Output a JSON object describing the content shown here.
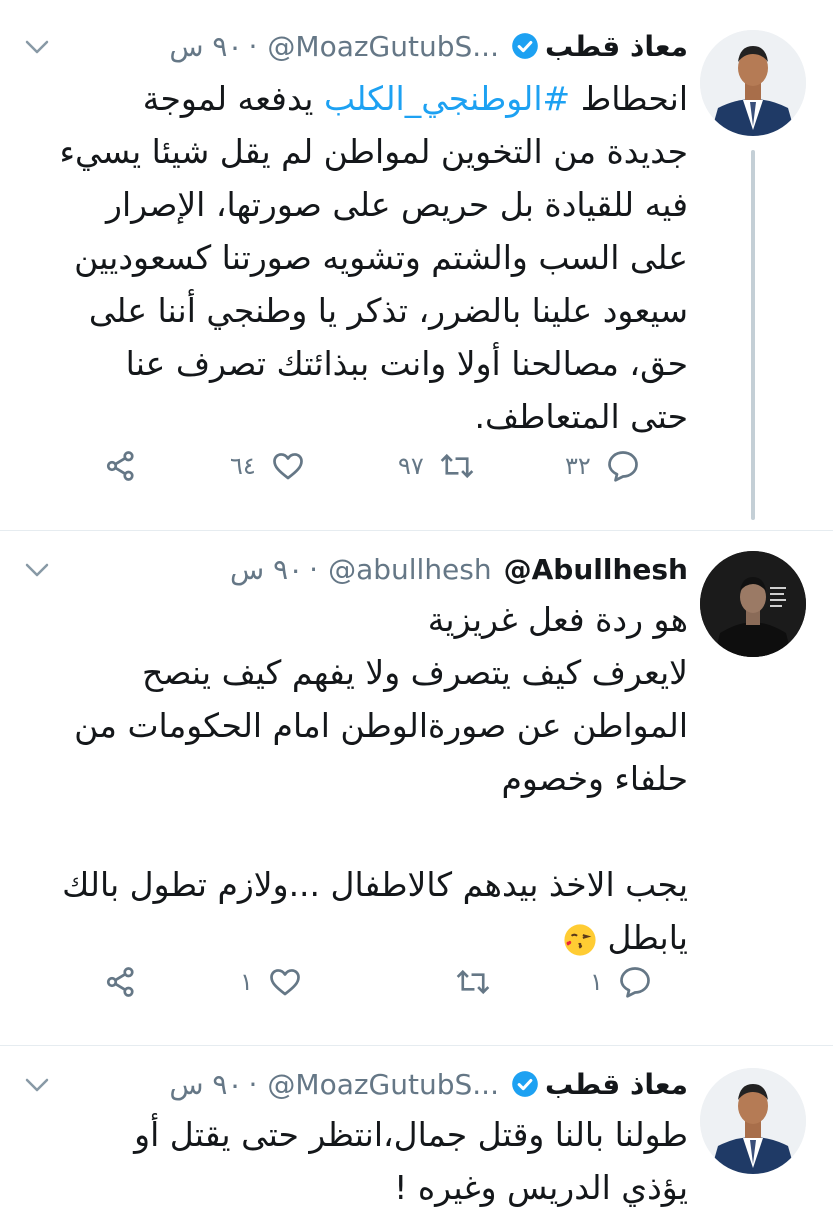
{
  "tweets": [
    {
      "name": "معاذ قطب",
      "verified": true,
      "handle": "@MoazGutubS...",
      "time": "٩٠ س",
      "hashtag": "#الوطنجي_الكلب",
      "lines": [
        "انحطاط",
        "يدفعه لموجة",
        "جديدة من التخوين لمواطن لم يقل شيئا يسيء",
        "فيه للقيادة بل حريص على صورتها، الإصرار",
        "على السب والشتم وتشويه صورتنا كسعوديين",
        "سيعود علينا بالضرر، تذكر يا وطنجي أننا على",
        "حق، مصالحنا أولا وانت ببذائتك تصرف عنا",
        "حتى المتعاطف."
      ],
      "replies": "٣٢",
      "retweets": "٩٧",
      "likes": "٦٤"
    },
    {
      "name": "@Abullhesh",
      "verified": false,
      "handle": "@abullhesh",
      "time": "٩٠ س",
      "lines": [
        "هو ردة فعل غريزية",
        "لايعرف كيف يتصرف ولا يفهم كيف ينصح",
        "المواطن عن صورةالوطن امام الحكومات من",
        "حلفاء وخصوم",
        "",
        "يجب الاخذ بيدهم كالاطفال ...ولازم تطول بالك",
        "يابطل"
      ],
      "replies": "١",
      "retweets": "",
      "likes": "١"
    },
    {
      "name": "معاذ قطب",
      "verified": true,
      "handle": "@MoazGutubS...",
      "time": "٩٠ س",
      "lines": [
        "طولنا بالنا وقتل جمال،انتظر حتى يقتل أو",
        "يؤذي الدريس وغيره !"
      ]
    }
  ],
  "colors": {
    "link": "#1da1f2",
    "secondary_text": "#657786",
    "thread_line": "#c4cfd6"
  },
  "icons": {
    "reply": "comment-bubble-icon",
    "retweet": "retweet-arrows-icon",
    "like": "heart-outline-icon",
    "share": "share-nodes-icon",
    "more": "chevron-down-icon",
    "verified": "verified-badge-icon",
    "emoji": "face-blowing-kiss-emoji"
  }
}
